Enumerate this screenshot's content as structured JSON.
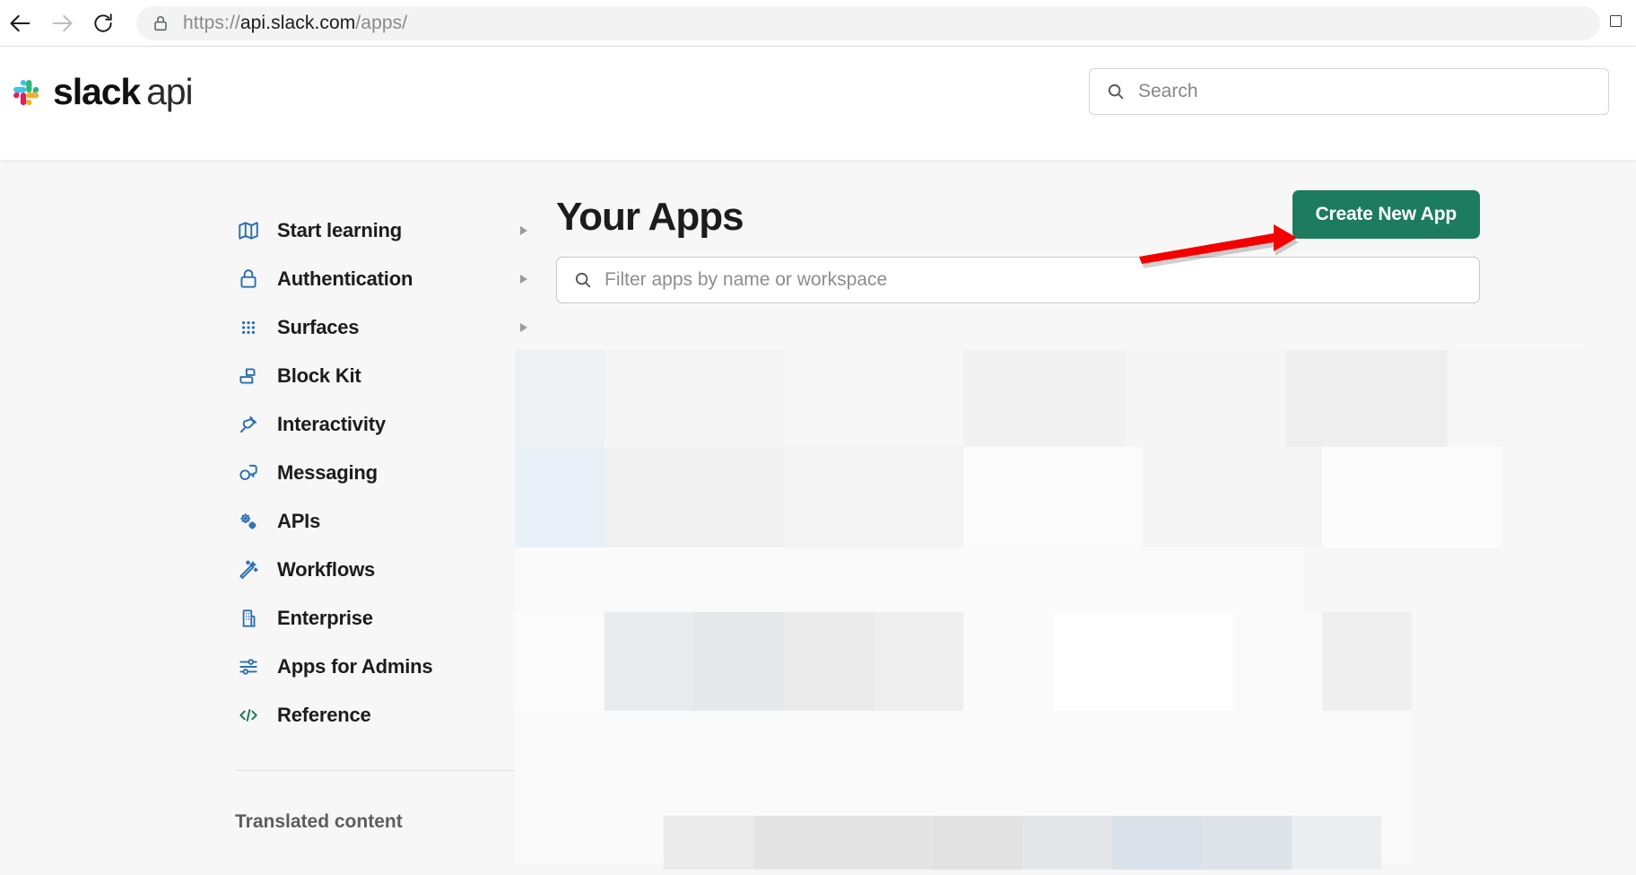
{
  "browser": {
    "back_icon": "arrow-left-icon",
    "forward_icon": "arrow-right-icon",
    "reload_icon": "reload-icon",
    "lock_icon": "lock-icon",
    "url_scheme": "https://",
    "url_host": "api.slack.com",
    "url_path": "/apps/",
    "url_full": "https://api.slack.com/apps/"
  },
  "header": {
    "logo_mark": "slack-logo-icon",
    "logo_bold": "slack",
    "logo_light": "api",
    "search": {
      "icon": "search-icon",
      "placeholder": "Search",
      "value": ""
    }
  },
  "sidebar": {
    "items": [
      {
        "label": "Start learning",
        "icon": "map-icon",
        "caret": true
      },
      {
        "label": "Authentication",
        "icon": "lock-icon",
        "caret": true
      },
      {
        "label": "Surfaces",
        "icon": "grid-dots-icon",
        "caret": true
      },
      {
        "label": "Block Kit",
        "icon": "blocks-icon",
        "caret": true
      },
      {
        "label": "Interactivity",
        "icon": "plug-icon",
        "caret": true
      },
      {
        "label": "Messaging",
        "icon": "chat-icon",
        "caret": true
      },
      {
        "label": "APIs",
        "icon": "gears-icon",
        "caret": true
      },
      {
        "label": "Workflows",
        "icon": "wand-icon",
        "caret": true
      },
      {
        "label": "Enterprise",
        "icon": "building-icon",
        "caret": true
      },
      {
        "label": "Apps for Admins",
        "icon": "sliders-icon",
        "caret": true
      },
      {
        "label": "Reference",
        "icon": "code-icon",
        "caret": false
      }
    ],
    "footer_heading": "Translated content"
  },
  "main": {
    "title": "Your Apps",
    "create_button": "Create New App",
    "filter": {
      "icon": "search-icon",
      "placeholder": "Filter apps by name or workspace",
      "value": ""
    },
    "loading_placeholder": "app-list-skeleton"
  },
  "annotation": {
    "arrow": "red-arrow-pointing-right",
    "target": "Create New App",
    "color": "#f40000"
  },
  "colors": {
    "brand_green": "#1d7b5e",
    "icon_blue": "#2a6fb0",
    "icon_green": "#1d7b5e",
    "page_bg": "#f7f7f7",
    "text": "#1d1c1d",
    "annotation_red": "#f40000"
  }
}
